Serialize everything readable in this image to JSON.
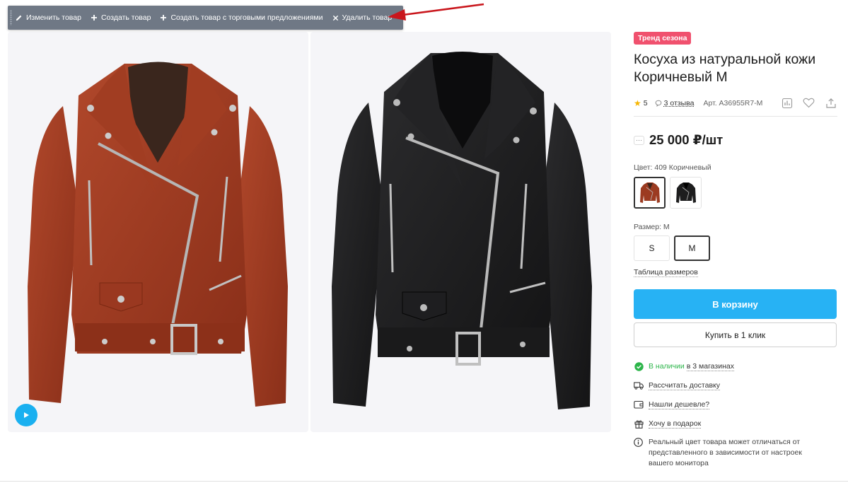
{
  "admin_bar": {
    "edit": "Изменить товар",
    "create": "Создать товар",
    "create_with_offers": "Создать товар с торговыми предложениями",
    "delete": "Удалить товар"
  },
  "product": {
    "badge": "Тренд сезона",
    "title": "Косуха из натуральной кожи Коричневый M",
    "rating": "5",
    "reviews": "3 отзыва",
    "sku": "Арт. A36955R7-M",
    "price": "25 000 ₽/шт",
    "color_label": "Цвет: 409 Коричневый",
    "size_label": "Размер: M",
    "sizes": [
      "S",
      "M"
    ],
    "selected_size": "M",
    "size_table": "Таблица размеров",
    "cart_button": "В корзину",
    "one_click_button": "Купить в 1 клик",
    "availability_status": "В наличии",
    "availability_stores": "в 3 магазинах",
    "calc_delivery": "Рассчитать доставку",
    "found_cheaper": "Нашли дешевле?",
    "want_gift": "Хочу в подарок",
    "color_note": "Реальный цвет товара может отличаться от представленного в зависимости от настроек вашего монитора"
  },
  "colors": {
    "accent": "#27b2f4",
    "badge": "#f0516e",
    "available": "#2cb54a",
    "admin_bar": "#6f7885"
  }
}
